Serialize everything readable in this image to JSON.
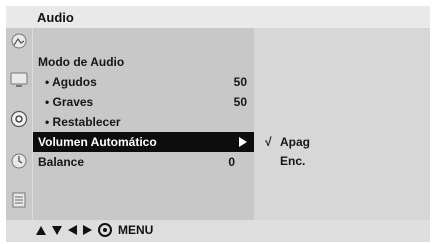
{
  "header": {
    "title": "Audio"
  },
  "sidebar": {
    "icons": [
      "picture-icon",
      "monitor-icon",
      "audio-icon",
      "clock-icon",
      "settings-icon"
    ],
    "active_icon": "audio-icon"
  },
  "menu": {
    "items": [
      {
        "label": "Modo de Audio",
        "value": ""
      },
      {
        "label": "• Agudos",
        "value": "50"
      },
      {
        "label": "• Graves",
        "value": "50"
      },
      {
        "label": "• Restablecer",
        "value": ""
      },
      {
        "label": "Volumen Automático",
        "value": ""
      },
      {
        "label": "Balance",
        "value": "0"
      }
    ],
    "selected_index": 4
  },
  "submenu": {
    "options": [
      {
        "check": "√",
        "label": "Apag"
      },
      {
        "check": "",
        "label": "Enc."
      }
    ]
  },
  "nav": {
    "menu_label": "MENU"
  },
  "colors": {
    "background": "#dcdcdc",
    "menu_panel": "#c8c8c8",
    "selected_row": "#0d0d0d",
    "text": "#161616"
  }
}
